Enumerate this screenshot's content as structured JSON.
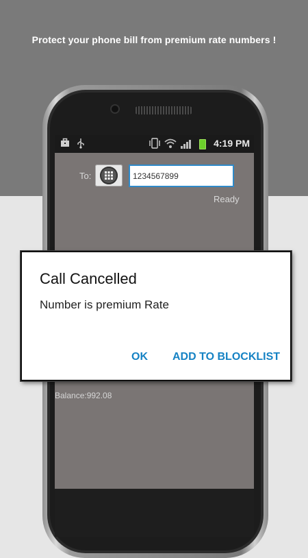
{
  "headline": "Protect your phone bill from premium rate numbers !",
  "status_bar": {
    "time": "4:19 PM",
    "icons": [
      "briefcase-icon",
      "usb-icon",
      "vibrate-icon",
      "wifi-icon",
      "signal-icon",
      "battery-icon"
    ]
  },
  "compose": {
    "to_label": "To:",
    "number_value": "1234567899",
    "status": "Ready",
    "balance": "Balance:992.08"
  },
  "dialog": {
    "title": "Call Cancelled",
    "message": "Number is premium Rate",
    "ok_label": "OK",
    "blocklist_label": "ADD TO BLOCKLIST"
  },
  "colors": {
    "accent": "#1582c4",
    "input_border": "#2f8ac9",
    "background_top": "#7a7a7a",
    "background_bottom": "#e6e6e6",
    "battery": "#6ccf2b"
  }
}
